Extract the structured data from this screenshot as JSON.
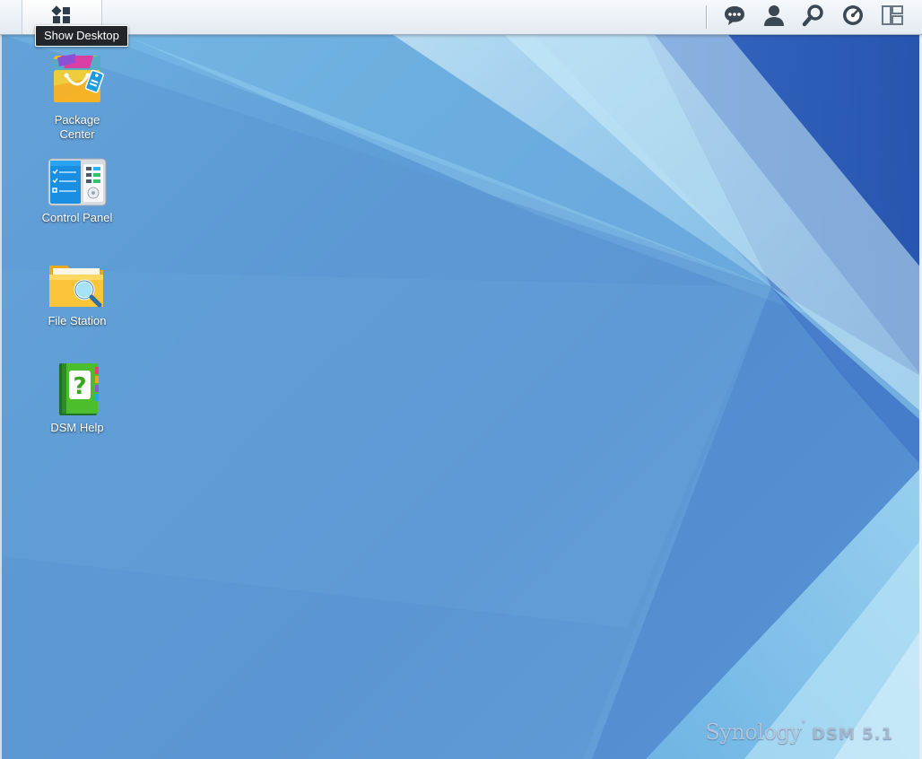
{
  "taskbar": {
    "show_desktop_tooltip": "Show Desktop",
    "icons": [
      "apps-grid-icon",
      "chat-icon",
      "user-icon",
      "search-icon",
      "gauge-icon",
      "widgets-icon"
    ]
  },
  "desktop": {
    "items": [
      {
        "label": "Package\nCenter",
        "icon": "package-center-icon"
      },
      {
        "label": "Control Panel",
        "icon": "control-panel-icon"
      },
      {
        "label": "File Station",
        "icon": "file-station-icon"
      },
      {
        "label": "DSM Help",
        "icon": "dsm-help-icon"
      }
    ]
  },
  "brand": {
    "name": "Synology",
    "version": "DSM 5.1"
  },
  "colors": {
    "desktop_blue": "#5e9ad4",
    "light_blue": "#8fd0f0",
    "taskbar_bg": "#eef2f6",
    "tooltip_bg": "#22262b"
  }
}
